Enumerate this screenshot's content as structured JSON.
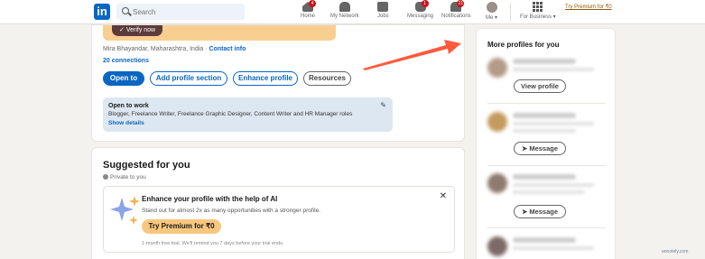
{
  "nav": {
    "logo": "in",
    "search_placeholder": "Search",
    "items": [
      {
        "label": "Home",
        "badge": "4"
      },
      {
        "label": "My Network",
        "badge": ""
      },
      {
        "label": "Jobs",
        "badge": ""
      },
      {
        "label": "Messaging",
        "badge": "1"
      },
      {
        "label": "Notifications",
        "badge": "21"
      }
    ],
    "me_label": "Me ▾",
    "business_label": "For Business ▾",
    "premium_link": "Try Premium for ₹0"
  },
  "profile": {
    "verify_label": "Verify now",
    "location": "Mira Bhayandar, Maharashtra, India · ",
    "contact_info": "Contact info",
    "connections": "20 connections",
    "buttons": {
      "open_to": "Open to",
      "add_section": "Add profile section",
      "enhance": "Enhance profile",
      "resources": "Resources"
    },
    "open_to_work": {
      "title": "Open to work",
      "roles": "Blogger, Freelance Writer, Freelance Graphic Designer, Content Writer and HR Manager roles",
      "show_details": "Show details"
    }
  },
  "suggested": {
    "title": "Suggested for you",
    "privacy": "Private to you",
    "ai_card": {
      "title": "Enhance your profile with the help of AI",
      "subtitle": "Stand out for almost 2x as many opportunities with a stronger profile.",
      "cta": "Try Premium for ₹0",
      "trial_note": "1-month free trial. We'll remind you 7 days before your trial ends.",
      "close": "✕"
    }
  },
  "sidebar": {
    "title": "More profiles for you",
    "buttons": {
      "view_profile": "View profile",
      "message": "Message"
    }
  },
  "watermark": "annotely.com",
  "colors": {
    "brand": "#0a66c2",
    "premium": "#f8c77e",
    "arrow": "#ff5a3c"
  }
}
